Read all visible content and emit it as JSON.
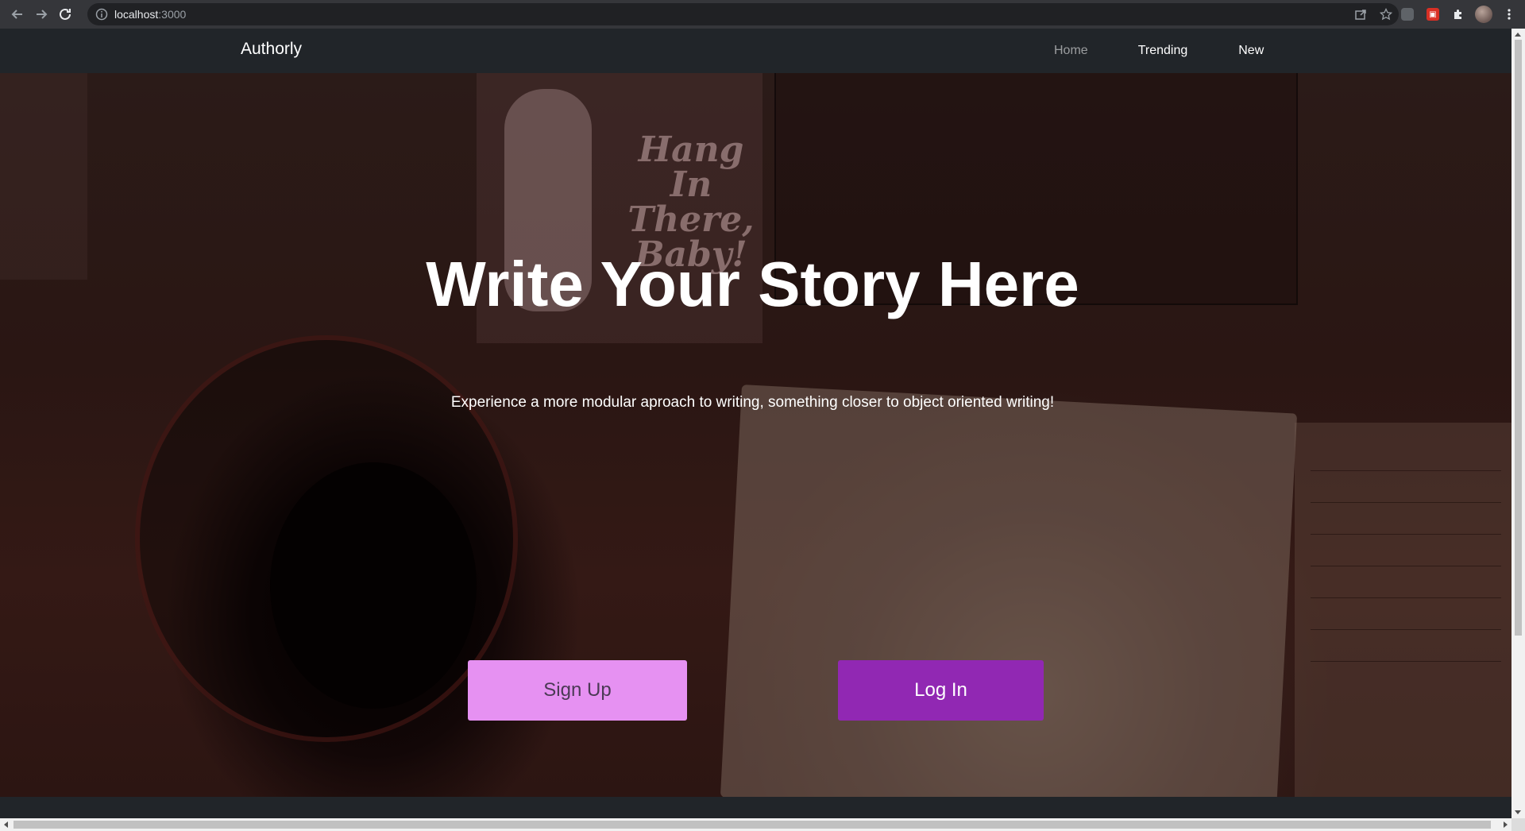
{
  "browser": {
    "url_host": "localhost",
    "url_port": ":3000"
  },
  "navbar": {
    "brand": "Authorly",
    "links": [
      {
        "label": "Home"
      },
      {
        "label": "Trending"
      },
      {
        "label": "New"
      }
    ]
  },
  "background_art": {
    "sign_text": "Hang In There, Baby!"
  },
  "hero": {
    "title": "Write Your Story Here",
    "subtitle": "Experience a more modular aproach to writing, something closer to object oriented writing!",
    "buttons": {
      "signup": "Sign Up",
      "login": "Log In"
    }
  },
  "colors": {
    "navbar_bg": "#212529",
    "signup_bg": "#e691f2",
    "login_bg": "#9128b3",
    "nav_active": "rgba(255,255,255,0.55)"
  }
}
